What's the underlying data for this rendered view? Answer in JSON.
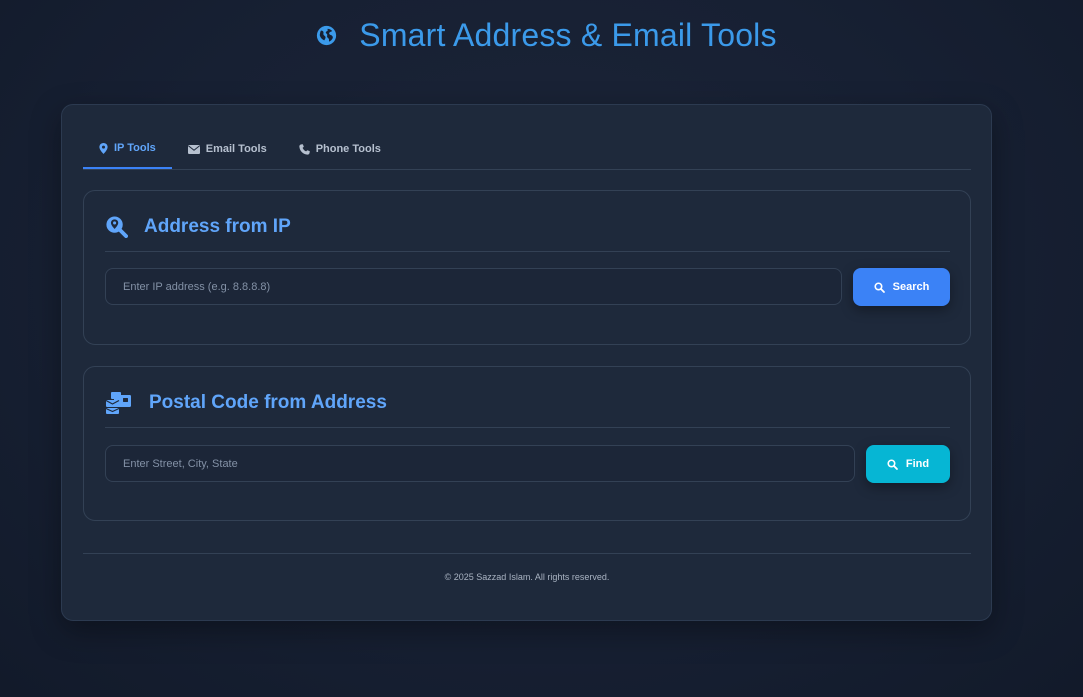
{
  "header": {
    "title": "Smart Address & Email Tools",
    "icon": "globe-icon",
    "accent_color": "#3b9aea"
  },
  "tabs": [
    {
      "label": "IP Tools",
      "icon": "map-marker-icon",
      "active": true
    },
    {
      "label": "Email Tools",
      "icon": "envelope-icon",
      "active": false
    },
    {
      "label": "Phone Tools",
      "icon": "phone-icon",
      "active": false
    }
  ],
  "ip_section": {
    "title": "Address from IP",
    "icon": "search-location-icon",
    "input": {
      "value": "",
      "placeholder": "Enter IP address (e.g. 8.8.8.8)"
    },
    "button_label": "Search",
    "button_color": "#3b82f6"
  },
  "postal_section": {
    "title": "Postal Code from Address",
    "icon": "mail-bulk-icon",
    "input": {
      "value": "",
      "placeholder": "Enter Street, City, State"
    },
    "button_label": "Find",
    "button_color": "#06b6d4"
  },
  "footer": {
    "text": "© 2025 Sazzad Islam. All rights reserved."
  }
}
